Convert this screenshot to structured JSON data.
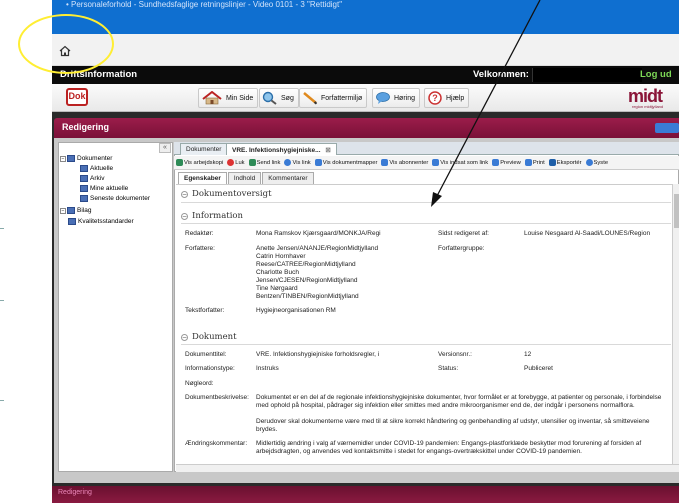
{
  "titlebar": {
    "text": "• Personaleforhold - Sundhedsfaglige retningslinjer - Video 0101 - 3 \"Rettidigt\""
  },
  "app": {
    "brand": "Driftsinformation",
    "welcome": "Velkommen:",
    "logout": "Log ud",
    "logo_text": "Dok",
    "midt_logo": "midt",
    "midt_sub": "region midtjylland"
  },
  "menu": {
    "items": [
      {
        "label": "Min Side",
        "icon": "home-icon"
      },
      {
        "label": "Søg",
        "icon": "search-icon"
      },
      {
        "label": "Forfattermiljø",
        "icon": "pencil-icon"
      },
      {
        "label": "Høring",
        "icon": "speech-bubble-icon"
      },
      {
        "label": "Hjælp",
        "icon": "help-icon"
      }
    ]
  },
  "panel": {
    "title": "Redigering",
    "collapse": "«"
  },
  "tree": {
    "items": [
      {
        "label": "Dokumenter",
        "level": 0
      },
      {
        "label": "Aktuelle",
        "level": 1
      },
      {
        "label": "Arkiv",
        "level": 1
      },
      {
        "label": "Mine aktuelle",
        "level": 1
      },
      {
        "label": "Seneste dokumenter",
        "level": 1
      },
      {
        "label": "Bilag",
        "level": 0
      },
      {
        "label": "Kvalitetsstandarder",
        "level": 1
      }
    ]
  },
  "doc_tabs": [
    {
      "label": "Dokumenter"
    },
    {
      "label": "VRE. Infektionshygiejniske..."
    }
  ],
  "actions": [
    {
      "label": "Vis arbejdskopi",
      "color": "#2e8b57"
    },
    {
      "label": "Luk",
      "color": "#d33"
    },
    {
      "label": "Send link",
      "color": "#2e8b57"
    },
    {
      "label": "Vis link",
      "color": "#3a7bd5"
    },
    {
      "label": "Vis dokumentmapper",
      "color": "#3a7bd5"
    },
    {
      "label": "Vis abonnenter",
      "color": "#3a7bd5"
    },
    {
      "label": "Vis indsat som link",
      "color": "#3a7bd5"
    },
    {
      "label": "Preview",
      "color": "#3a7bd5"
    },
    {
      "label": "Print",
      "color": "#3a7bd5"
    },
    {
      "label": "Eksportér",
      "color": "#1f5fa8"
    },
    {
      "label": "Syste",
      "color": "#3a7bd5"
    }
  ],
  "sub_tabs": [
    {
      "label": "Egenskaber"
    },
    {
      "label": "Indhold"
    },
    {
      "label": "Kommentarer"
    }
  ],
  "overview": {
    "title": "Dokumentoversigt"
  },
  "information": {
    "title": "Information",
    "redaktor_label": "Redaktør:",
    "redaktor": "Mona Ramskov Kjærsgaard/MONKJA/Regi",
    "sidst_label": "Sidst redigeret af:",
    "sidst": "Louise Nesgaard Al-Saadi/LOUNES/Region",
    "forfattere_label": "Forfattere:",
    "forfattere": [
      "Anette Jensen/ANANJE/RegionMidtjylland",
      "Catrin Hornhaver",
      "Reese/CATREE/RegionMidtjylland",
      "Charlotte Buch",
      "Jensen/CJESEN/RegionMidtjylland",
      "Tine Nørgaard",
      "Bentzen/TINBEN/RegionMidtjylland"
    ],
    "forfattergruppe_label": "Forfattergruppe:",
    "tekstforfatter_label": "Tekstforfatter:",
    "tekstforfatter": "Hygiejneorganisationen RM"
  },
  "dokument": {
    "title": "Dokument",
    "titel_label": "Dokumenttitel:",
    "titel": "VRE. Infektionshygiejniske forholdsregler, i",
    "version_label": "Versionsnr.:",
    "version": "12",
    "infotype_label": "Informationstype:",
    "infotype": "Instruks",
    "status_label": "Status:",
    "status": "Publiceret",
    "noegleord_label": "Nøgleord:",
    "beskrivelse_label": "Dokumentbeskrivelse:",
    "beskrivelse": "Dokumentet er en del af de regionale infektionshygiejniske dokumenter, hvor formålet er at forebygge, at patienter og personale, i forbindelse med ophold på hospital, pådrager sig infektion eller smittes med andre mikroorganismer end de, der indgår i personens normalflora.",
    "beskrivelse2": "Derudover skal dokumenterne være med til at sikre korrekt håndtering og genbehandling af udstyr, utensilier og inventar, så smitteveiene brydes.",
    "aendring_label": "Ændringskommentar:",
    "aendring": "Midlertidig ændring i valg af værnemidler under COVID-19 pandemien: Engangs-plastforklæde beskytter mod forurening af forsiden af arbejdsdragten, og anvendes ved kontaktsmitte i stedet for engangs-overtrækskittel under COVID-19 pandemien."
  },
  "statusbar": {
    "text": "Redigering"
  }
}
